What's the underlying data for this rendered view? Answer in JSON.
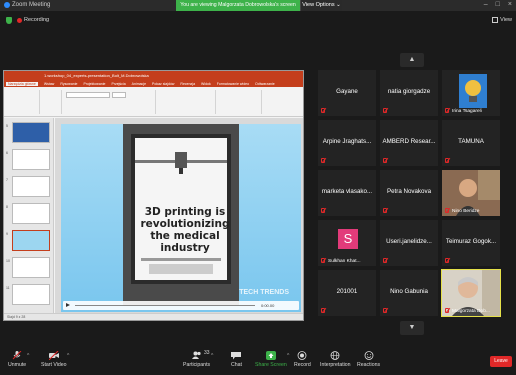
{
  "titlebar": {
    "app_name": "Zoom Meeting",
    "viewing_banner": "You are viewing Malgorzata Dobrowolska's screen",
    "view_options": "View Options ⌄"
  },
  "topbar": {
    "recording": "Recording",
    "view": "View"
  },
  "ppt": {
    "title": "1.workshop_04_experts-presentation_Bolt_M.Dobrowolska",
    "tabs": [
      "Narzędzia główne",
      "Wstaw",
      "Rysowanie",
      "Projektowanie",
      "Przejścia",
      "Animacje",
      "Pokaz slajdów",
      "Recenzja",
      "Widok",
      "Formatowanie wideo",
      "Odtwarzanie"
    ],
    "slide": {
      "headline": "3D printing is revolutionizing the medical industry",
      "logo": "TECH TRENDS",
      "time": "0:00.00"
    },
    "status": "Slajd 9 z 28"
  },
  "participants": [
    {
      "name": "Gayane",
      "type": "name"
    },
    {
      "name": "natia giorgadze",
      "type": "name"
    },
    {
      "name": "Irina Tsagareli",
      "type": "photo"
    },
    {
      "name": "Arpine Jraghats...",
      "type": "name"
    },
    {
      "name": "AMBERD Resear...",
      "type": "name"
    },
    {
      "name": "TAMUNA",
      "type": "name"
    },
    {
      "name": "marketa vlasako...",
      "type": "name"
    },
    {
      "name": "Petra Novakova",
      "type": "name"
    },
    {
      "name": "Nino Beridze",
      "type": "photo"
    },
    {
      "name": "Sulkhan Khat...",
      "type": "avatar",
      "initial": "S"
    },
    {
      "name": "Useri.janelidze...",
      "type": "name"
    },
    {
      "name": "Teimuraz Gogok...",
      "type": "name"
    },
    {
      "name": "201001",
      "type": "name"
    },
    {
      "name": "Nino Gabunia",
      "type": "name"
    },
    {
      "name": "Malgorzata Dob...",
      "type": "photo"
    }
  ],
  "toolbar": {
    "unmute": "Unmute",
    "start_video": "Start Video",
    "participants": "Participants",
    "participants_count": "33",
    "chat": "Chat",
    "share_screen": "Share Screen",
    "record": "Record",
    "interpretation": "Interpretation",
    "reactions": "Reactions",
    "leave": "Leave"
  },
  "colors": {
    "accent_green": "#3db24a",
    "leave_red": "#e02828",
    "ppt_red": "#c43e1c",
    "avatar_pink": "#e23b7a"
  }
}
